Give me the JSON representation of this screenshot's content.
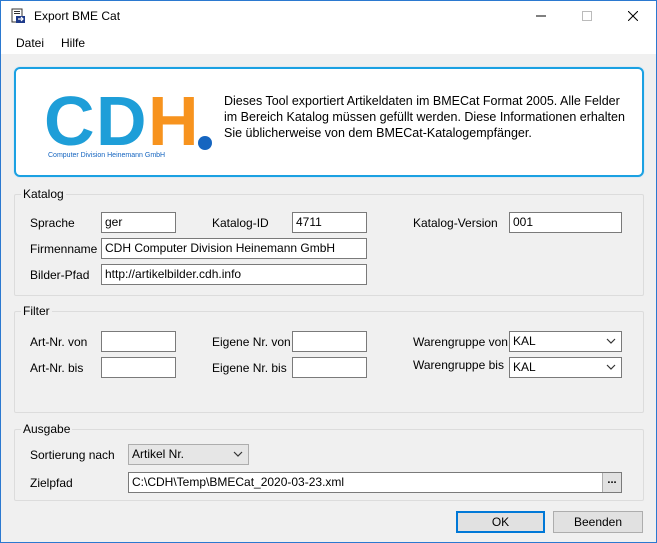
{
  "window": {
    "title": "Export BME Cat"
  },
  "menu": {
    "items": [
      "Datei",
      "Hilfe"
    ]
  },
  "banner": {
    "logo_text": "CDH",
    "logo_subtitle": "Computer Division Heinemann GmbH",
    "description": "Dieses Tool exportiert Artikeldaten im BMECat Format 2005. Alle Felder im Bereich Katalog müssen gefüllt werden. Diese Informationen erhalten Sie üblicherweise von dem BMECat-Katalogempfänger.",
    "colors": {
      "blue": "#1e9ed8",
      "orange": "#f7931e",
      "dark_blue": "#1565c0"
    }
  },
  "katalog": {
    "title": "Katalog",
    "sprache_label": "Sprache",
    "sprache_value": "ger",
    "katalog_id_label": "Katalog-ID",
    "katalog_id_value": "4711",
    "katalog_version_label": "Katalog-Version",
    "katalog_version_value": "001",
    "firmenname_label": "Firmenname",
    "firmenname_value": "CDH Computer Division Heinemann GmbH",
    "bilder_pfad_label": "Bilder-Pfad",
    "bilder_pfad_value": "http://artikelbilder.cdh.info"
  },
  "filter": {
    "title": "Filter",
    "art_nr_von_label": "Art-Nr. von",
    "art_nr_von_value": "",
    "art_nr_bis_label": "Art-Nr. bis",
    "art_nr_bis_value": "",
    "eigene_nr_von_label": "Eigene Nr. von",
    "eigene_nr_von_value": "",
    "eigene_nr_bis_label": "Eigene Nr. bis",
    "eigene_nr_bis_value": "",
    "warengruppe_von_label": "Warengruppe von",
    "warengruppe_von_value": "KAL",
    "warengruppe_bis_label": "Warengruppe bis",
    "warengruppe_bis_value": "KAL"
  },
  "ausgabe": {
    "title": "Ausgabe",
    "sortierung_label": "Sortierung nach",
    "sortierung_value": "Artikel Nr.",
    "zielpfad_label": "Zielpfad",
    "zielpfad_value": "C:\\CDH\\Temp\\BMECat_2020-03-23.xml",
    "browse_label": "..."
  },
  "buttons": {
    "ok": "OK",
    "beenden": "Beenden"
  }
}
